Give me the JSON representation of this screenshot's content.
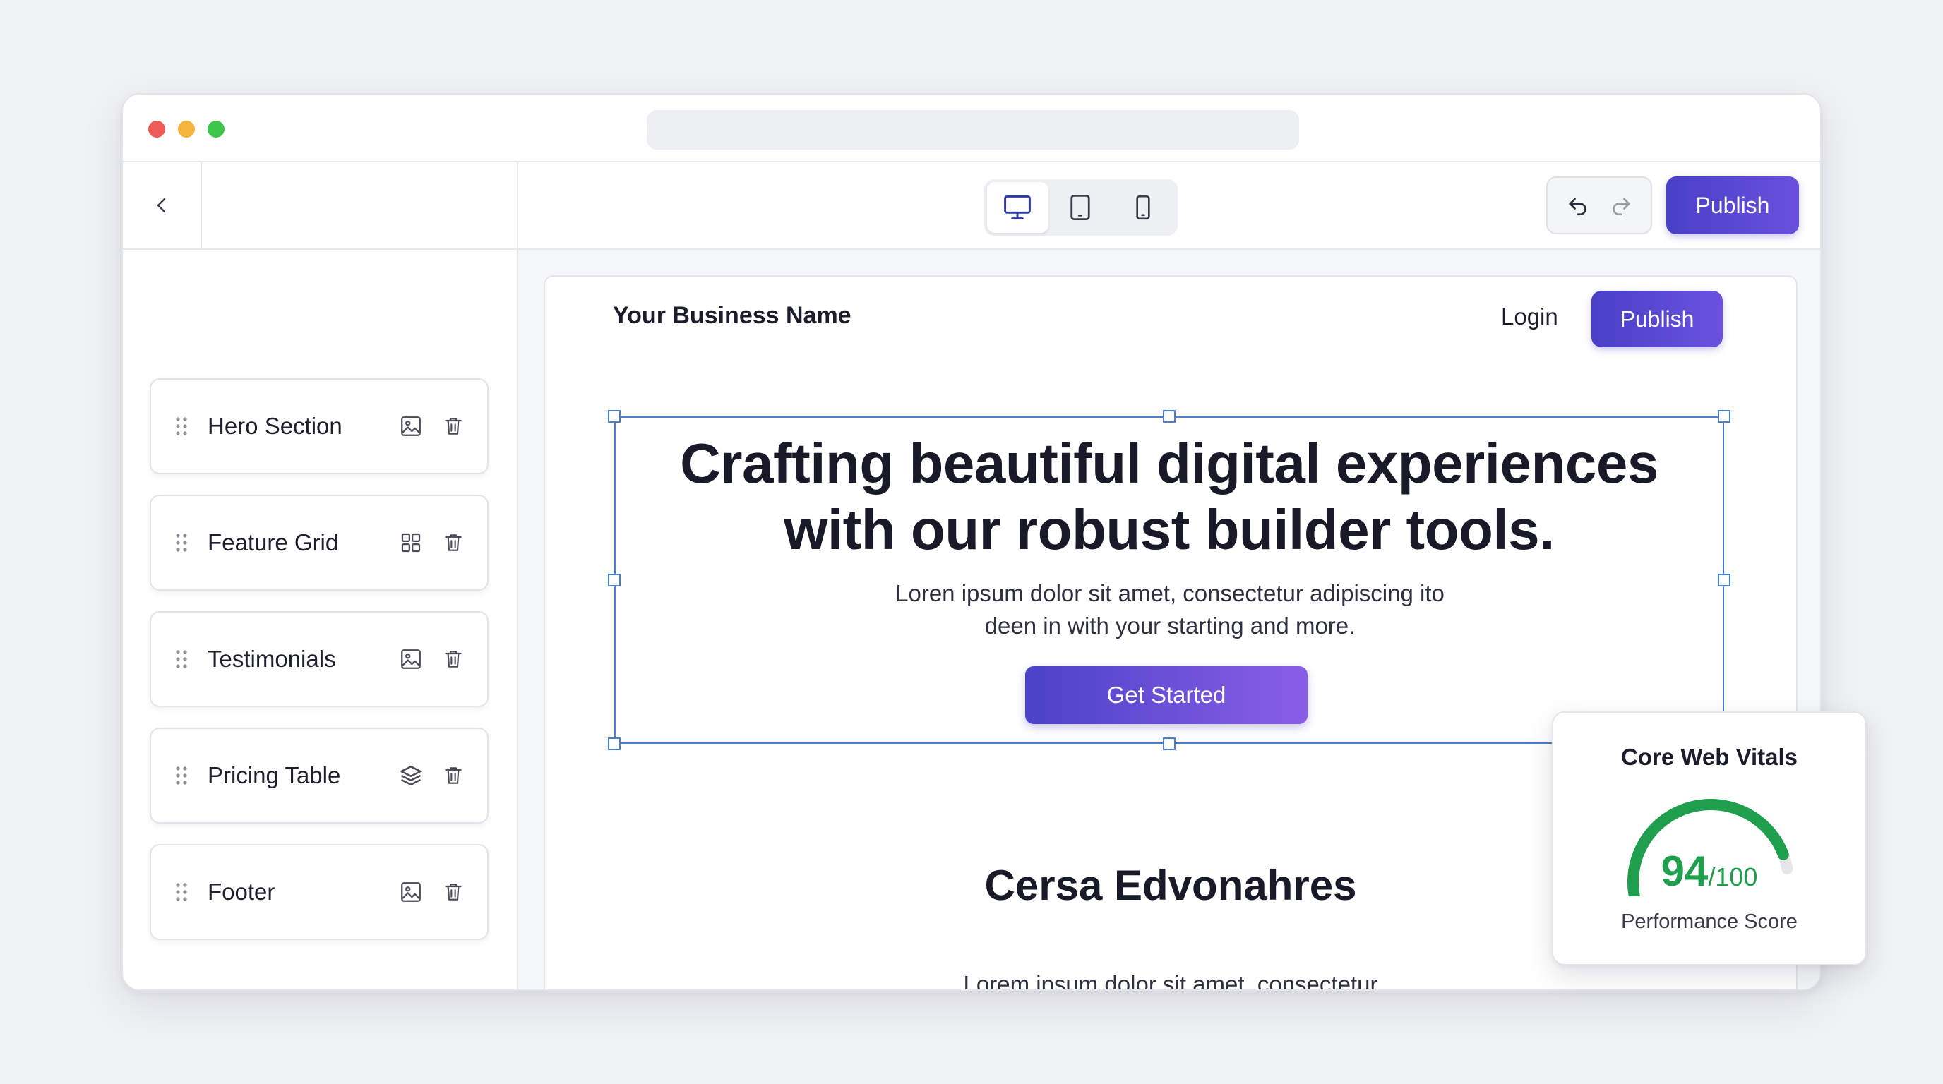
{
  "toolbar": {
    "publish_label": "Publish"
  },
  "sidebar": {
    "sections": [
      {
        "label": "Hero Section",
        "icon": "image-icon"
      },
      {
        "label": "Feature Grid",
        "icon": "grid-icon"
      },
      {
        "label": "Testimonials",
        "icon": "image-icon"
      },
      {
        "label": "Pricing Table",
        "icon": "layers-icon"
      },
      {
        "label": "Footer",
        "icon": "image-icon"
      }
    ]
  },
  "preview": {
    "business_name": "Your Business Name",
    "login_label": "Login",
    "publish_label": "Publish",
    "hero_title_line1": "Crafting beautiful digital experiences",
    "hero_title_line2": "with our robust builder tools.",
    "hero_subtitle_line1": "Loren ipsum dolor sit amet, consectetur adipiscing ito",
    "hero_subtitle_line2": "deen in with your starting and more.",
    "cta_label": "Get Started",
    "section_heading": "Cersa Edvonahres",
    "section_text": "Lorem ipsum dolor sit amet, consectetur"
  },
  "core_web_vitals": {
    "title": "Core Web Vitals",
    "score": "94",
    "max": "/100",
    "score_fraction": 0.94,
    "label": "Performance Score",
    "gauge_color": "#1f9e4d",
    "track_color": "#e4e6ea"
  },
  "colors": {
    "accent": "#4840c6",
    "selection": "#4a7fd1"
  }
}
